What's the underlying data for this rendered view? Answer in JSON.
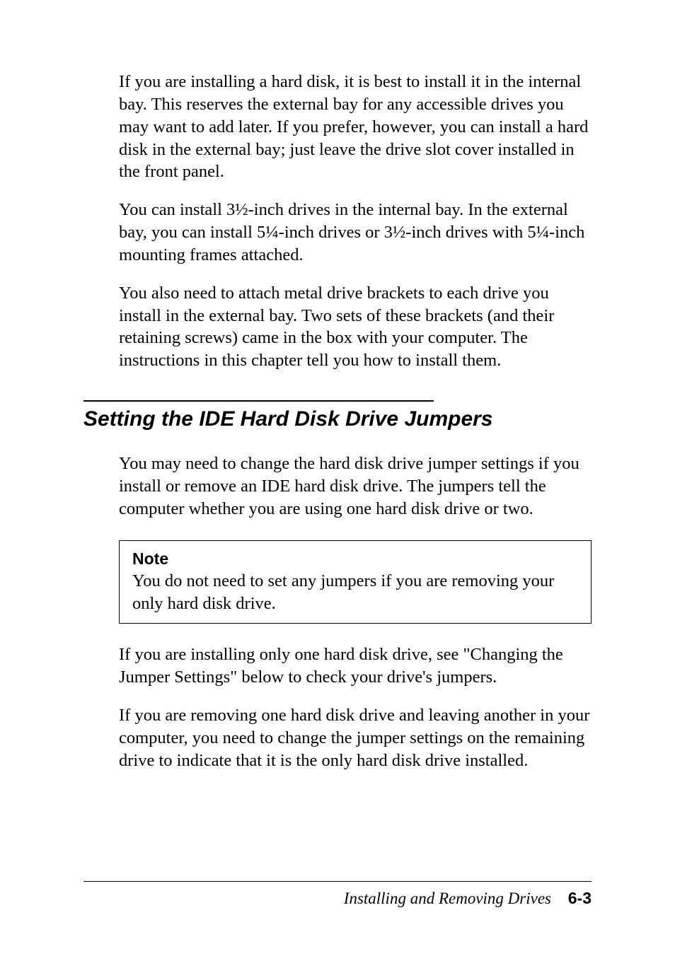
{
  "paragraphs": {
    "p1": "If you are installing a hard disk, it is best to install it in the internal bay. This reserves the external bay for any accessible drives you may want to add later. If you prefer, however, you can install a hard disk in the external bay; just leave the drive slot cover installed in the front panel.",
    "p2": "You can install 3½-inch drives in the internal bay. In the external bay, you can install 5¼-inch drives or 3½-inch drives with 5¼-inch mounting frames attached.",
    "p3": "You also need to attach metal drive brackets to each drive you install in the external bay. Two sets of these brackets (and their retaining screws) came in the box with your computer. The instructions in this chapter tell you how to install them.",
    "p4": "You may need to change the hard disk drive jumper settings if you install or remove an IDE hard disk drive. The jumpers tell the computer whether you are using one hard disk drive or two.",
    "p5": "If you are installing only one hard disk drive, see \"Changing the Jumper Settings\" below to check your drive's jumpers.",
    "p6": "If you are removing one hard disk drive and leaving another in your computer, you need to change the jumper settings on the remaining drive to indicate that it is the only hard disk drive installed."
  },
  "section": {
    "heading": "Setting the IDE Hard Disk Drive Jumpers"
  },
  "note": {
    "title": "Note",
    "text": "You do not need to set any jumpers if you are removing your only hard disk drive."
  },
  "footer": {
    "title": "Installing and Removing Drives",
    "page": "6-3"
  }
}
